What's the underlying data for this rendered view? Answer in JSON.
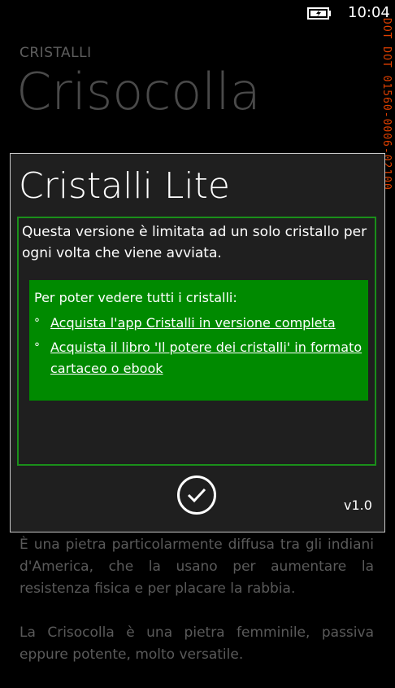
{
  "status": {
    "time": "10:04",
    "battery_icon": "battery-charging-icon"
  },
  "header": {
    "section": "CRISTALLI",
    "title": "Crisocolla"
  },
  "side_strip": {
    "text": "DOT DOT 01560-0006-02100",
    "colors": [
      "#e04000",
      "#ffffff"
    ]
  },
  "dialog": {
    "title": "Cristalli Lite",
    "intro": "Questa versione è limitata ad un solo cristallo per ogni volta che viene avviata.",
    "panel_title": "Per poter vedere tutti i cristalli:",
    "links": [
      {
        "bullet": "°",
        "label": "Acquista l'app Cristalli in versione completa"
      },
      {
        "bullet": "°",
        "label": "Acquista il libro 'Il potere dei cristalli' in formato cartaceo o ebook"
      }
    ],
    "ok_icon": "checkmark-icon",
    "version": "v1.0"
  },
  "body": {
    "paragraphs": [
      "È una pietra particolarmente diffusa tra gli indiani d'America, che la usano per aumentare la resistenza fisica e per placare la rabbia.",
      "La Crisocolla è una pietra femminile, passiva eppure potente, molto versatile."
    ]
  },
  "colors": {
    "accent_green": "#008a00",
    "frame_green": "#1a8f1a",
    "dialog_bg": "#1f1f1f"
  }
}
